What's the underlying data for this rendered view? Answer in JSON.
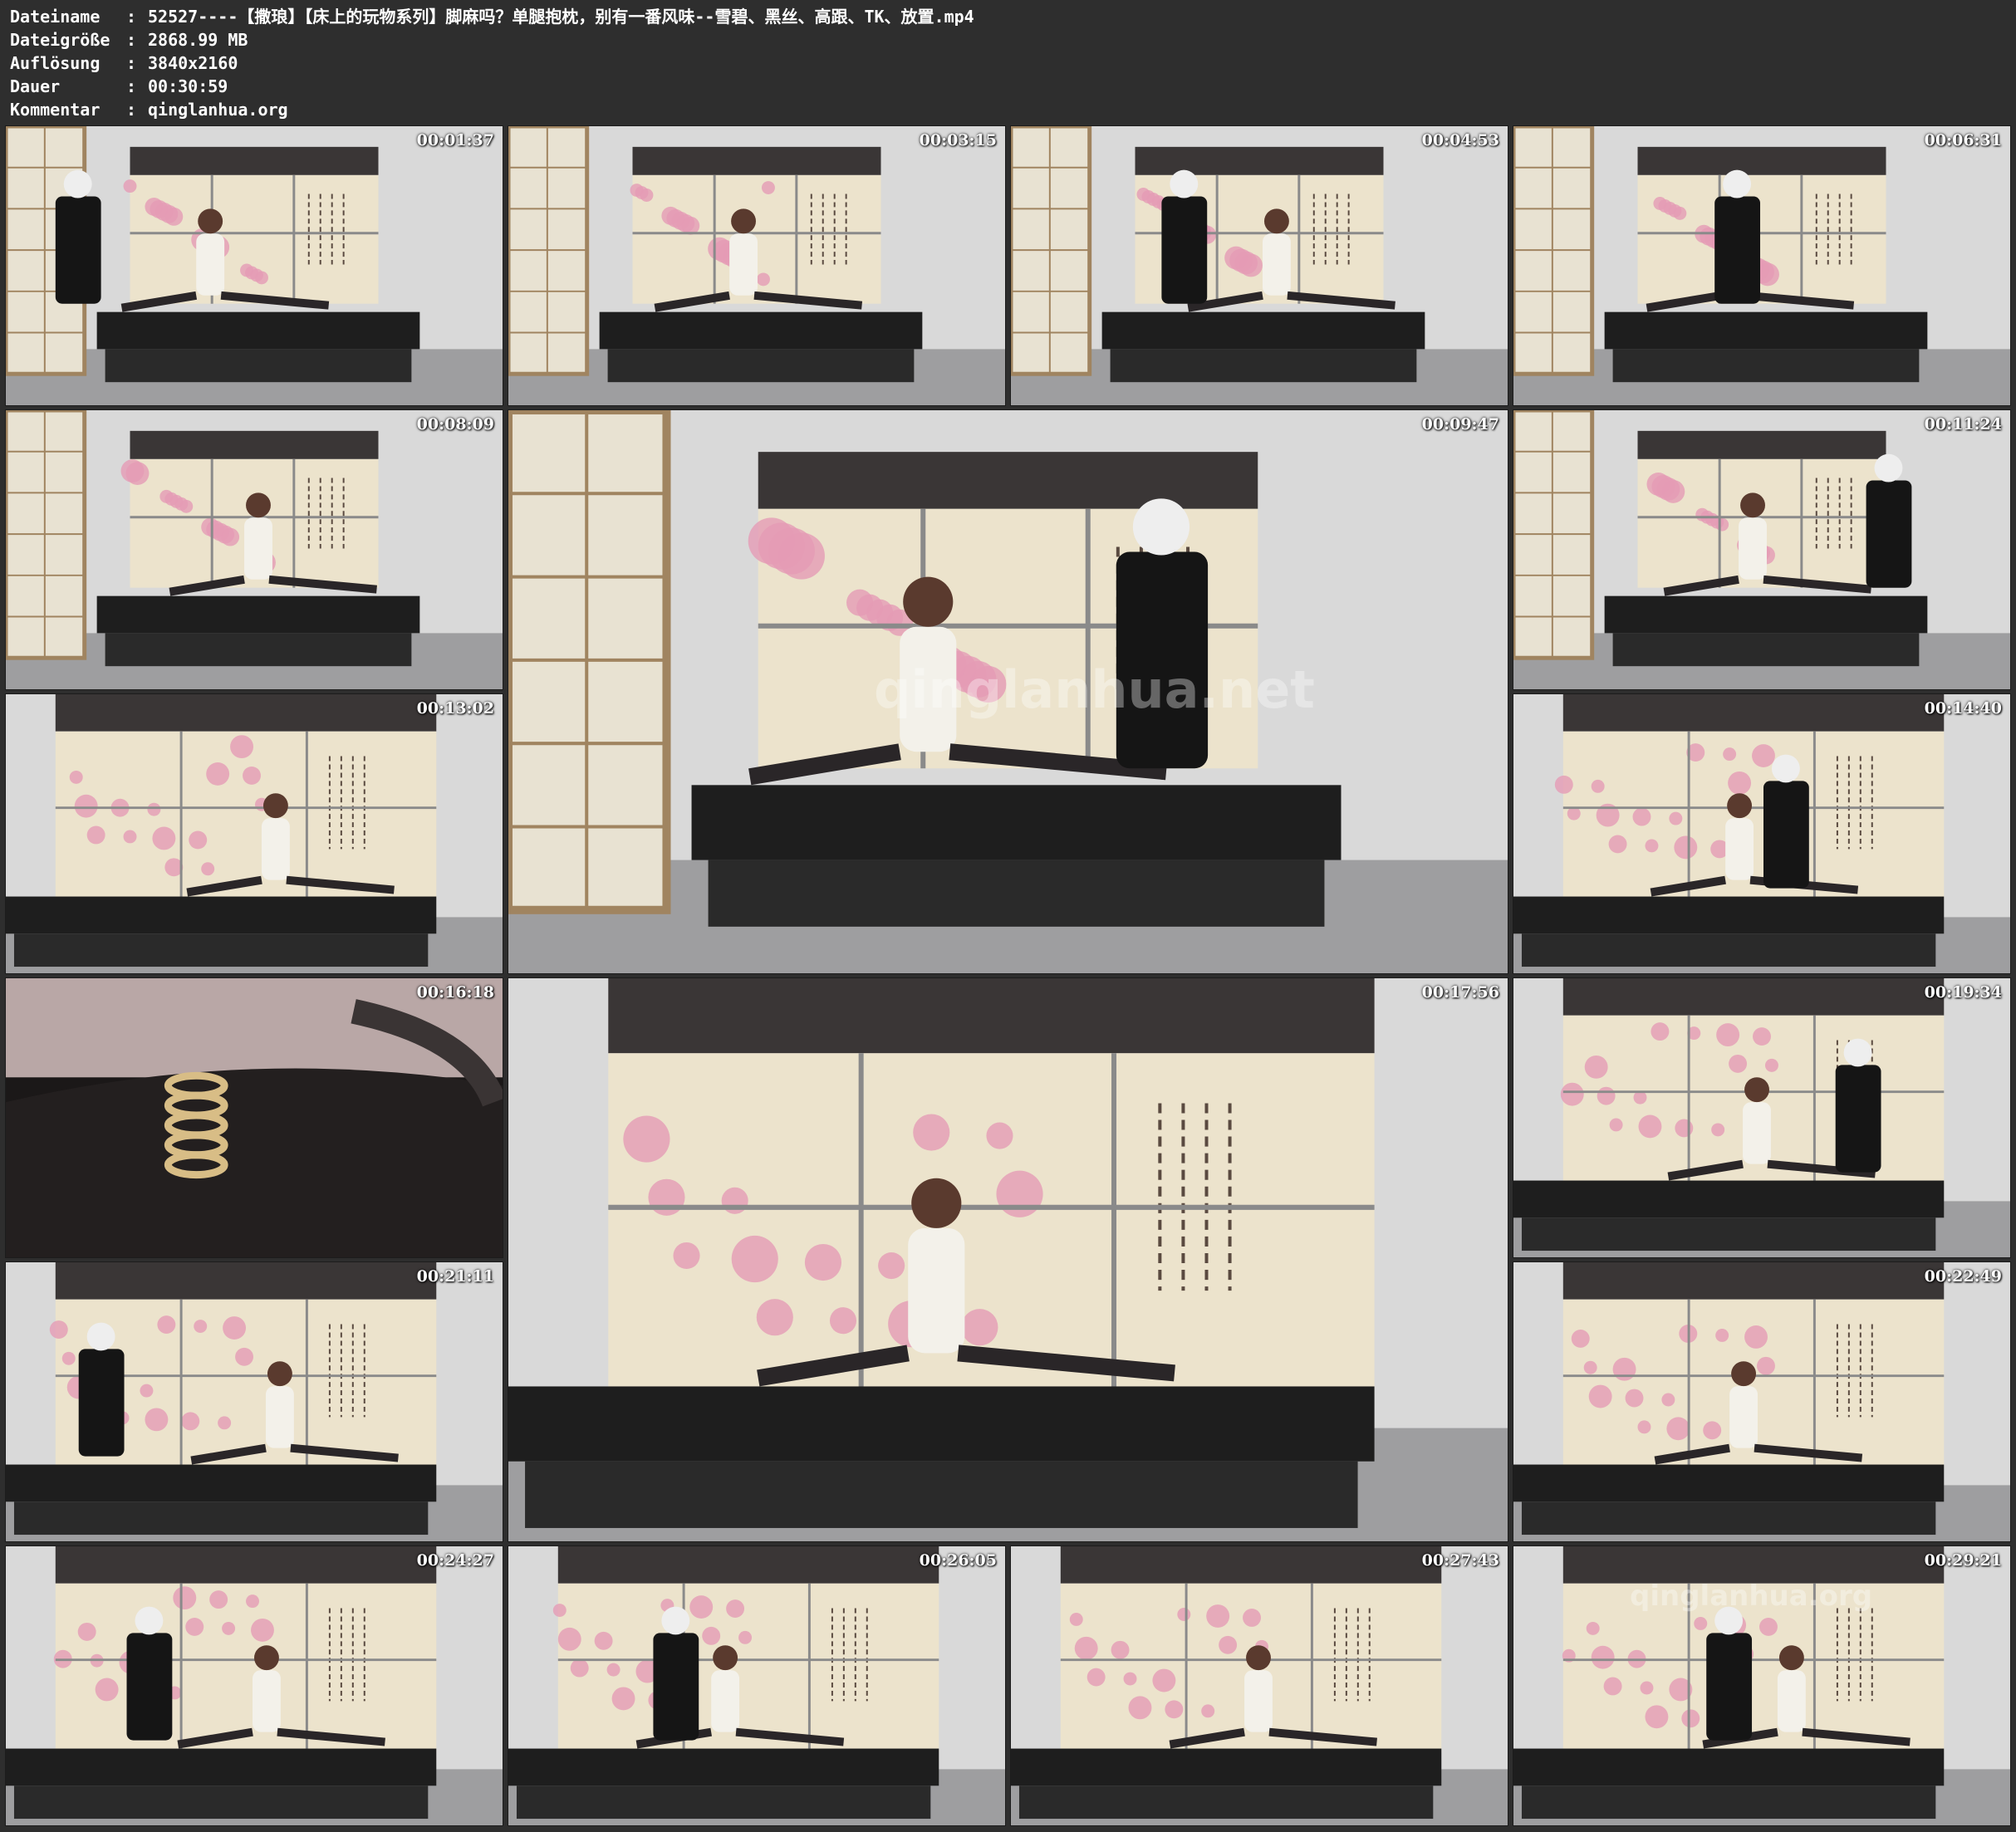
{
  "header": {
    "rows": [
      {
        "key": "Dateiname",
        "value": "52527----【撒琅】【床上的玩物系列】脚麻吗？单腿抱枕，别有一番风味--雪碧、黑丝、高跟、TK、放置.mp4"
      },
      {
        "key": "Dateigröße",
        "value": "2868.99 MB"
      },
      {
        "key": "Auflösung",
        "value": "3840x2160"
      },
      {
        "key": "Dauer",
        "value": "00:30:59"
      },
      {
        "key": "Kommentar",
        "value": "qinglanhua.org"
      }
    ]
  },
  "thumbnails": [
    {
      "time": "00:01:37",
      "scene": "wide"
    },
    {
      "time": "00:03:15",
      "scene": "wide"
    },
    {
      "time": "00:04:53",
      "scene": "wide"
    },
    {
      "time": "00:06:31",
      "scene": "wide"
    },
    {
      "time": "00:08:09",
      "scene": "wide"
    },
    {
      "time": "00:09:47",
      "scene": "wide"
    },
    {
      "time": "00:11:24",
      "scene": "wide"
    },
    {
      "time": "00:13:02",
      "scene": "medium"
    },
    {
      "time": "00:14:40",
      "scene": "medium"
    },
    {
      "time": "00:16:18",
      "scene": "closeup"
    },
    {
      "time": "00:17:56",
      "scene": "medium"
    },
    {
      "time": "00:19:34",
      "scene": "medium"
    },
    {
      "time": "00:21:11",
      "scene": "medium"
    },
    {
      "time": "00:22:49",
      "scene": "medium"
    },
    {
      "time": "00:24:27",
      "scene": "medium"
    },
    {
      "time": "00:26:05",
      "scene": "medium"
    },
    {
      "time": "00:27:43",
      "scene": "medium"
    },
    {
      "time": "00:29:21",
      "scene": "medium"
    }
  ],
  "watermarks": {
    "center": "qinglanhua.net",
    "corner": "qinglanhua.org"
  },
  "colors": {
    "background": "#2e2e2e",
    "header_text": "#ffffff",
    "timestamp": "#ffffff"
  }
}
